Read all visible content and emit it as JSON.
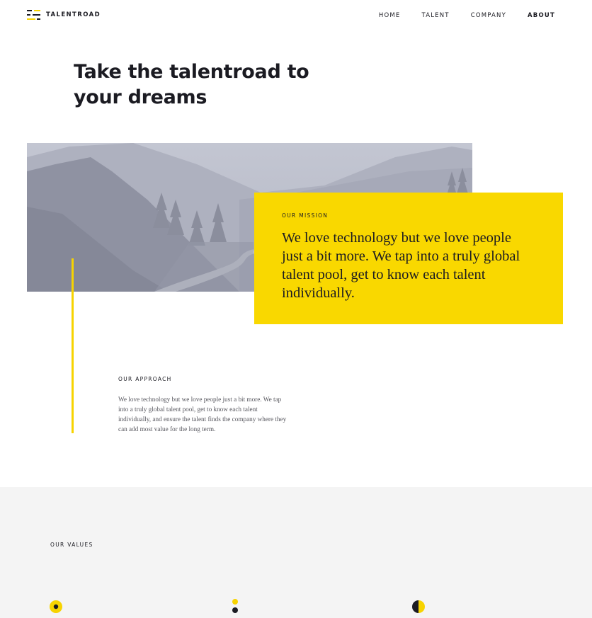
{
  "header": {
    "logo_text": "TALENTROAD",
    "nav": [
      {
        "label": "HOME",
        "active": false
      },
      {
        "label": "TALENT",
        "active": false
      },
      {
        "label": "COMPANY",
        "active": false
      },
      {
        "label": "ABOUT",
        "active": true
      }
    ]
  },
  "hero": {
    "title_line1": "Take the talentroad to",
    "title_line2": "your dreams"
  },
  "mission": {
    "label": "OUR MISSION",
    "text": "We love technology but we love people just a bit more. We tap into a truly global talent pool, get to know each talent individually."
  },
  "approach": {
    "label": "OUR APPROACH",
    "text": "We love technology but we love people just a bit more. We tap into a truly global talent pool, get to know each talent individually, and ensure the talent finds the company where they can add most value for the long term."
  },
  "values": {
    "label": "OUR VALUES"
  },
  "colors": {
    "accent": "#f9d800",
    "dark": "#1b1b22",
    "values_bg": "#f4f4f4"
  },
  "icons": [
    "logo-icon",
    "target-dot-icon",
    "two-dots-icon",
    "half-circle-icon"
  ]
}
